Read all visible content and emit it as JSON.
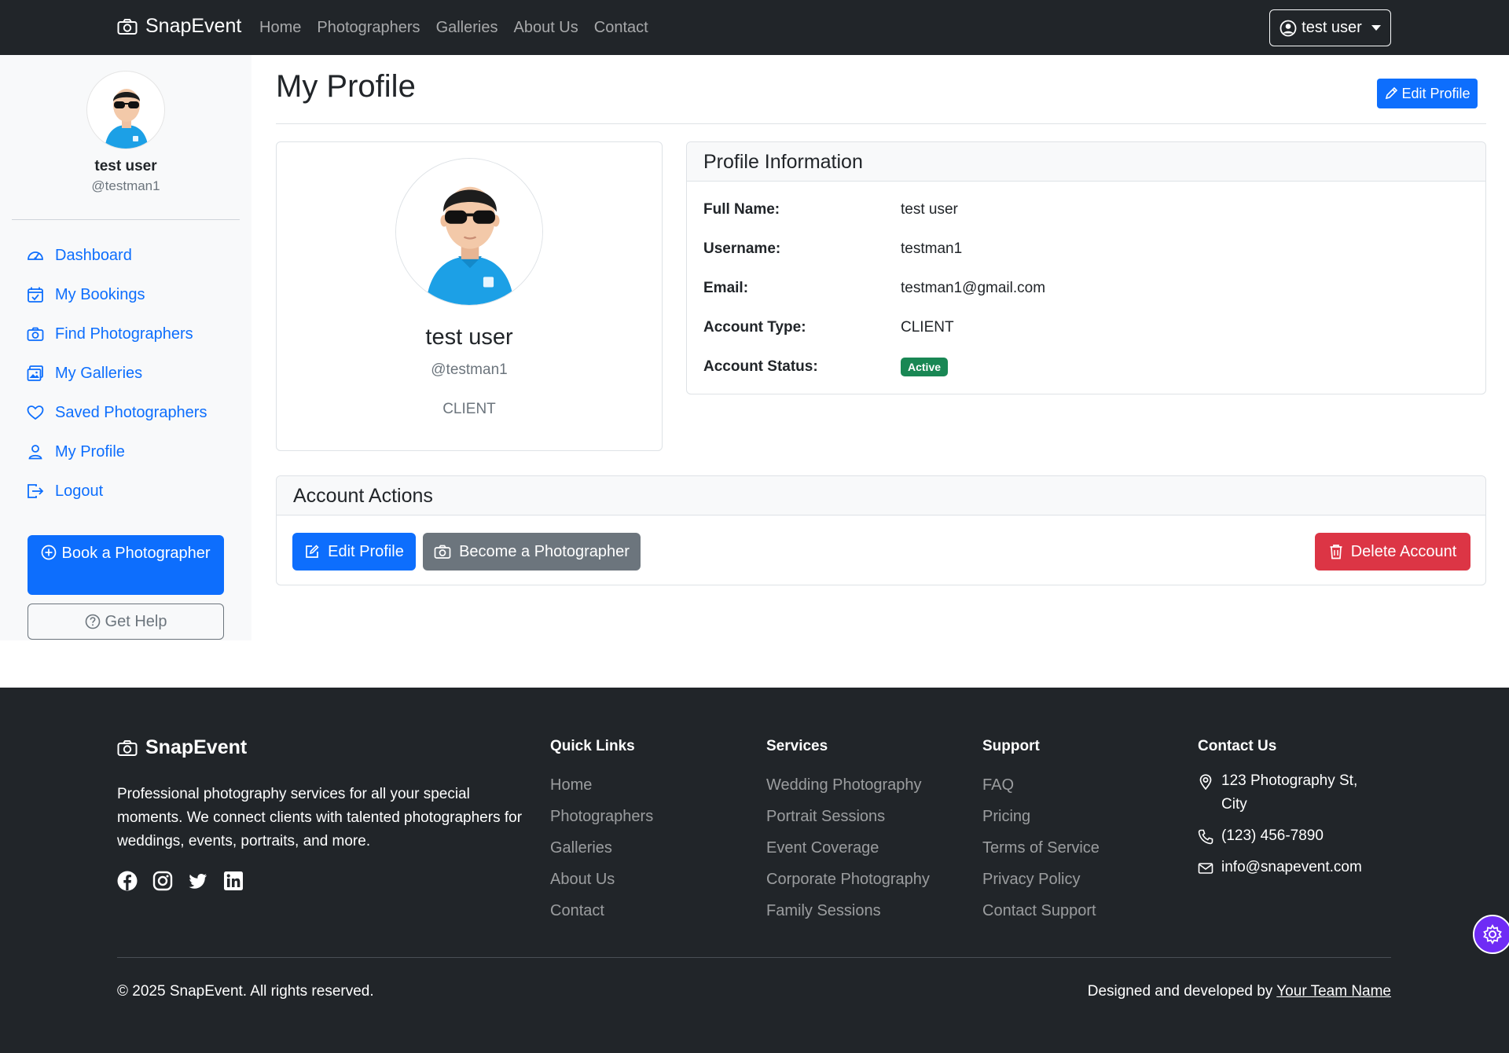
{
  "navbar": {
    "brand": "SnapEvent",
    "links": [
      "Home",
      "Photographers",
      "Galleries",
      "About Us",
      "Contact"
    ],
    "user_menu_label": "test user"
  },
  "sidebar": {
    "name": "test user",
    "username": "@testman1",
    "items": [
      {
        "label": "Dashboard",
        "icon": "speedometer-icon"
      },
      {
        "label": "My Bookings",
        "icon": "calendar-check-icon"
      },
      {
        "label": "Find Photographers",
        "icon": "camera-icon"
      },
      {
        "label": "My Galleries",
        "icon": "images-icon"
      },
      {
        "label": "Saved Photographers",
        "icon": "heart-icon"
      },
      {
        "label": "My Profile",
        "icon": "person-icon"
      },
      {
        "label": "Logout",
        "icon": "logout-icon"
      }
    ],
    "book_button": "Book a Photographer",
    "help_button": "Get Help"
  },
  "main": {
    "title": "My Profile",
    "edit_button": "Edit Profile",
    "profile_card": {
      "name": "test user",
      "username": "@testman1",
      "account_type": "CLIENT"
    },
    "info": {
      "title": "Profile Information",
      "rows": [
        {
          "label": "Full Name:",
          "value": "test user"
        },
        {
          "label": "Username:",
          "value": "testman1"
        },
        {
          "label": "Email:",
          "value": "testman1@gmail.com"
        },
        {
          "label": "Account Type:",
          "value": "CLIENT"
        },
        {
          "label": "Account Status:",
          "value": "Active"
        }
      ]
    },
    "actions": {
      "title": "Account Actions",
      "edit": "Edit Profile",
      "become": "Become a Photographer",
      "delete": "Delete Account"
    }
  },
  "footer": {
    "brand": "SnapEvent",
    "description": "Professional photography services for all your special moments. We connect clients with talented photographers for weddings, events, portraits, and more.",
    "social": [
      "facebook-icon",
      "instagram-icon",
      "twitter-icon",
      "linkedin-icon"
    ],
    "quick_links": {
      "title": "Quick Links",
      "items": [
        "Home",
        "Photographers",
        "Galleries",
        "About Us",
        "Contact"
      ]
    },
    "services": {
      "title": "Services",
      "items": [
        "Wedding Photography",
        "Portrait Sessions",
        "Event Coverage",
        "Corporate Photography",
        "Family Sessions"
      ]
    },
    "support": {
      "title": "Support",
      "items": [
        "FAQ",
        "Pricing",
        "Terms of Service",
        "Privacy Policy",
        "Contact Support"
      ]
    },
    "contact": {
      "title": "Contact Us",
      "address": "123 Photography St, City",
      "phone": "(123) 456-7890",
      "email": "info@snapevent.com"
    },
    "copyright": "© 2025 SnapEvent. All rights reserved.",
    "credit_prefix": "Designed and developed by ",
    "credit_link": "Your Team Name"
  },
  "colors": {
    "primary": "#0d6efd",
    "secondary": "#6c757d",
    "danger": "#dc3545",
    "success": "#198754",
    "dark": "#212529",
    "floating": "#6f2cf5"
  }
}
